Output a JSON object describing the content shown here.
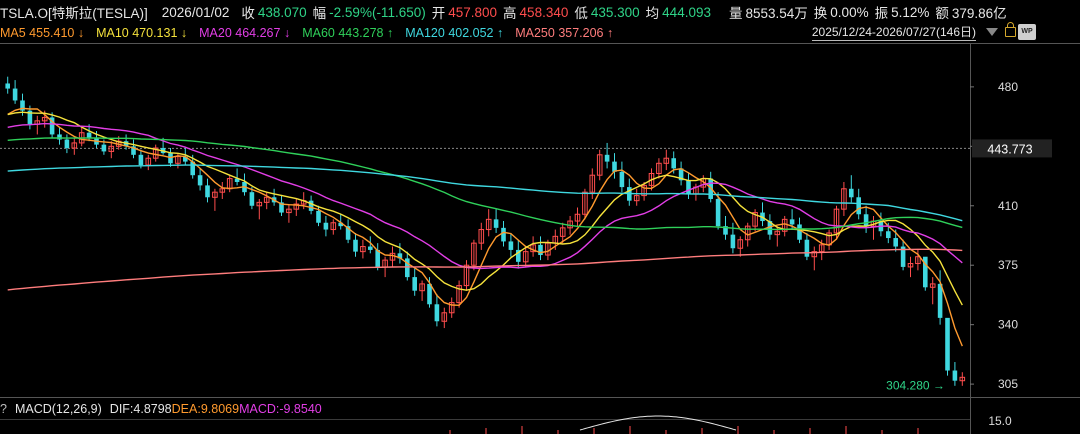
{
  "quote": {
    "symbol": "TSLA.O[特斯拉(TESLA)]",
    "date": "2026/01/02",
    "close_label": "收",
    "close": "438.070",
    "chg_label": "幅",
    "chg": "-2.59%(-11.650)",
    "open_label": "开",
    "open": "457.800",
    "high_label": "高",
    "high": "458.340",
    "low_label": "低",
    "low": "435.300",
    "avg_label": "均",
    "avg": "444.093",
    "vol_label": "量",
    "vol": "8553.54万",
    "turn_label": "换",
    "turn": "0.00%",
    "amp_label": "振",
    "amp": "5.12%",
    "amt_label": "额",
    "amt": "379.86亿"
  },
  "ma": [
    {
      "label": "MA5 455.410",
      "arrow": "↓",
      "color": "#ff9a2e"
    },
    {
      "label": "MA10 470.131",
      "arrow": "↓",
      "color": "#f5e23c"
    },
    {
      "label": "MA20 464.267",
      "arrow": "↓",
      "color": "#e23ee6"
    },
    {
      "label": "MA60 443.278",
      "arrow": "↑",
      "color": "#2fd05a"
    },
    {
      "label": "MA120 402.052",
      "arrow": "↑",
      "color": "#3fd8e0"
    },
    {
      "label": "MA250 357.206",
      "arrow": "↑",
      "color": "#ff7d7d"
    }
  ],
  "range": "2025/12/24-2026/07/27(146日)",
  "icons": {
    "range_dropdown": "triangle-down-icon",
    "lock": "lock-icon",
    "wp": "wp-icon"
  },
  "wp_text": "WP",
  "macd": {
    "help": "?",
    "title": "MACD(12,26,9)",
    "dif": "DIF:4.8798",
    "dea": "DEA:9.8069",
    "macd": "MACD:-9.8540",
    "top_tick": "15.0"
  },
  "chart_data": {
    "type": "candlestick",
    "y_ticks": [
      480,
      445,
      410,
      375,
      340,
      305
    ],
    "ylim": [
      298,
      497
    ],
    "current_price_label": "443.773",
    "current_price": 443.773,
    "low_marker_label": "304.280",
    "low_marker_value": 304.28,
    "colors": {
      "up": "#ff4d4d",
      "down": "#3fd8e0"
    },
    "candles": [
      [
        482,
        486,
        476,
        479
      ],
      [
        479,
        484,
        470,
        472
      ],
      [
        472,
        476,
        463,
        466
      ],
      [
        466,
        469,
        455,
        458
      ],
      [
        458,
        463,
        452,
        460
      ],
      [
        460,
        466,
        456,
        462
      ],
      [
        462,
        465,
        450,
        452
      ],
      [
        452,
        456,
        446,
        449
      ],
      [
        449,
        452,
        441,
        444
      ],
      [
        444,
        450,
        440,
        447
      ],
      [
        447,
        456,
        445,
        453
      ],
      [
        453,
        458,
        448,
        450
      ],
      [
        450,
        454,
        444,
        446
      ],
      [
        446,
        449,
        440,
        442
      ],
      [
        442,
        448,
        438,
        445
      ],
      [
        445,
        451,
        443,
        448
      ],
      [
        448,
        452,
        443,
        445
      ],
      [
        445,
        449,
        438,
        440
      ],
      [
        440,
        443,
        432,
        434
      ],
      [
        434,
        440,
        431,
        438
      ],
      [
        438,
        446,
        436,
        444
      ],
      [
        444,
        450,
        440,
        441
      ],
      [
        441,
        444,
        433,
        435
      ],
      [
        435,
        441,
        432,
        439
      ],
      [
        439,
        444,
        434,
        436
      ],
      [
        436,
        440,
        426,
        428
      ],
      [
        428,
        432,
        419,
        422
      ],
      [
        422,
        426,
        412,
        415
      ],
      [
        415,
        420,
        407,
        418
      ],
      [
        418,
        424,
        414,
        420
      ],
      [
        420,
        428,
        418,
        426
      ],
      [
        426,
        432,
        422,
        424
      ],
      [
        424,
        429,
        416,
        418
      ],
      [
        418,
        421,
        408,
        410
      ],
      [
        410,
        414,
        402,
        412
      ],
      [
        412,
        418,
        408,
        415
      ],
      [
        415,
        420,
        410,
        412
      ],
      [
        412,
        416,
        404,
        406
      ],
      [
        406,
        411,
        400,
        408
      ],
      [
        408,
        414,
        404,
        411
      ],
      [
        411,
        418,
        408,
        413
      ],
      [
        413,
        416,
        405,
        407
      ],
      [
        407,
        410,
        398,
        400
      ],
      [
        400,
        404,
        392,
        396
      ],
      [
        396,
        402,
        393,
        400
      ],
      [
        400,
        405,
        396,
        398
      ],
      [
        398,
        402,
        388,
        390
      ],
      [
        390,
        394,
        380,
        383
      ],
      [
        383,
        390,
        379,
        386
      ],
      [
        386,
        392,
        382,
        384
      ],
      [
        384,
        388,
        372,
        374
      ],
      [
        374,
        380,
        368,
        378
      ],
      [
        378,
        386,
        374,
        382
      ],
      [
        382,
        388,
        376,
        379
      ],
      [
        379,
        383,
        366,
        368
      ],
      [
        368,
        373,
        357,
        360
      ],
      [
        360,
        366,
        354,
        364
      ],
      [
        364,
        368,
        350,
        352
      ],
      [
        352,
        358,
        339,
        342
      ],
      [
        342,
        350,
        338,
        347
      ],
      [
        347,
        356,
        344,
        353
      ],
      [
        353,
        366,
        350,
        363
      ],
      [
        363,
        378,
        360,
        375
      ],
      [
        375,
        390,
        372,
        388
      ],
      [
        388,
        400,
        384,
        396
      ],
      [
        396,
        408,
        392,
        402
      ],
      [
        402,
        408,
        394,
        397
      ],
      [
        397,
        401,
        386,
        389
      ],
      [
        389,
        394,
        380,
        384
      ],
      [
        384,
        390,
        373,
        377
      ],
      [
        377,
        386,
        374,
        383
      ],
      [
        383,
        392,
        380,
        387
      ],
      [
        387,
        392,
        378,
        381
      ],
      [
        381,
        390,
        378,
        388
      ],
      [
        388,
        396,
        384,
        392
      ],
      [
        392,
        400,
        388,
        397
      ],
      [
        397,
        404,
        393,
        401
      ],
      [
        401,
        409,
        398,
        405
      ],
      [
        405,
        420,
        402,
        418
      ],
      [
        418,
        432,
        414,
        428
      ],
      [
        428,
        443,
        425,
        440
      ],
      [
        440,
        447,
        432,
        436
      ],
      [
        436,
        441,
        426,
        430
      ],
      [
        430,
        436,
        418,
        421
      ],
      [
        421,
        426,
        410,
        413
      ],
      [
        413,
        420,
        410,
        416
      ],
      [
        416,
        424,
        413,
        422
      ],
      [
        422,
        432,
        419,
        429
      ],
      [
        429,
        438,
        426,
        435
      ],
      [
        435,
        443,
        431,
        438
      ],
      [
        438,
        442,
        429,
        432
      ],
      [
        432,
        436,
        422,
        425
      ],
      [
        425,
        429,
        414,
        417
      ],
      [
        417,
        423,
        413,
        421
      ],
      [
        421,
        428,
        418,
        426
      ],
      [
        426,
        430,
        412,
        414
      ],
      [
        414,
        418,
        396,
        398
      ],
      [
        398,
        404,
        390,
        393
      ],
      [
        393,
        400,
        382,
        385
      ],
      [
        385,
        392,
        380,
        390
      ],
      [
        390,
        400,
        386,
        398
      ],
      [
        398,
        408,
        395,
        406
      ],
      [
        406,
        412,
        398,
        401
      ],
      [
        401,
        405,
        390,
        393
      ],
      [
        393,
        398,
        386,
        395
      ],
      [
        395,
        404,
        392,
        402
      ],
      [
        402,
        408,
        396,
        399
      ],
      [
        399,
        403,
        388,
        390
      ],
      [
        390,
        394,
        378,
        380
      ],
      [
        380,
        386,
        372,
        383
      ],
      [
        383,
        390,
        378,
        387
      ],
      [
        387,
        396,
        384,
        394
      ],
      [
        394,
        410,
        390,
        408
      ],
      [
        408,
        424,
        404,
        420
      ],
      [
        420,
        428,
        412,
        415
      ],
      [
        415,
        420,
        402,
        405
      ],
      [
        405,
        410,
        394,
        398
      ],
      [
        398,
        404,
        390,
        401
      ],
      [
        401,
        406,
        392,
        395
      ],
      [
        395,
        400,
        388,
        391
      ],
      [
        391,
        396,
        383,
        386
      ],
      [
        386,
        390,
        372,
        374
      ],
      [
        374,
        380,
        368,
        376
      ],
      [
        376,
        384,
        372,
        380
      ],
      [
        380,
        366,
        360,
        362
      ],
      [
        362,
        368,
        352,
        364
      ],
      [
        364,
        372,
        340,
        344
      ],
      [
        344,
        332,
        310,
        313
      ],
      [
        313,
        318,
        304,
        307
      ],
      [
        307,
        312,
        304,
        309
      ]
    ],
    "ma_series": [
      {
        "name": "MA5",
        "color": "#ff9a2e"
      },
      {
        "name": "MA10",
        "color": "#f5e23c"
      },
      {
        "name": "MA20",
        "color": "#e23ee6"
      },
      {
        "name": "MA60",
        "color": "#2fd05a"
      },
      {
        "name": "MA120",
        "color": "#3fd8e0"
      },
      {
        "name": "MA250",
        "color": "#ff7d7d"
      }
    ]
  }
}
